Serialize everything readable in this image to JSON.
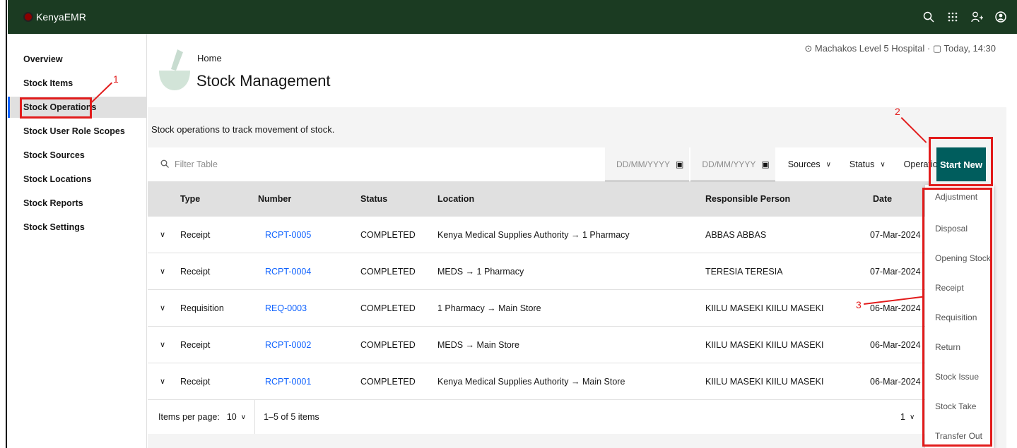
{
  "app": {
    "name": "KenyaEMR"
  },
  "topbar": {
    "icons": [
      "search-icon",
      "app-switcher-icon",
      "add-user-icon",
      "user-avatar-icon"
    ]
  },
  "sidenav": {
    "items": [
      {
        "label": "Overview"
      },
      {
        "label": "Stock Items"
      },
      {
        "label": "Stock Operations"
      },
      {
        "label": "Stock User Role Scopes"
      },
      {
        "label": "Stock Sources"
      },
      {
        "label": "Stock Locations"
      },
      {
        "label": "Stock Reports"
      },
      {
        "label": "Stock Settings"
      }
    ]
  },
  "header": {
    "breadcrumb": "Home",
    "title": "Stock Management",
    "facility": "Machakos Level 5 Hospital",
    "separator": "·",
    "datetime": "Today, 14:30"
  },
  "content": {
    "description": "Stock operations to track movement of stock.",
    "filter_placeholder": "Filter Table",
    "date_from_placeholder": "DD/MM/YYYY",
    "date_to_placeholder": "DD/MM/YYYY",
    "sources_label": "Sources",
    "status_label": "Status",
    "operation_label": "Operation",
    "start_new_label": "Start New"
  },
  "table": {
    "columns": [
      "Type",
      "Number",
      "Status",
      "Location",
      "Responsible Person",
      "Date"
    ],
    "rows": [
      {
        "type": "Receipt",
        "number": "RCPT-0005",
        "status": "COMPLETED",
        "location": "Kenya Medical Supplies Authority → 1 Pharmacy",
        "person": "ABBAS ABBAS",
        "date": "07-Mar-2024"
      },
      {
        "type": "Receipt",
        "number": "RCPT-0004",
        "status": "COMPLETED",
        "location": "MEDS → 1 Pharmacy",
        "person": "TERESIA TERESIA",
        "date": "07-Mar-2024"
      },
      {
        "type": "Requisition",
        "number": "REQ-0003",
        "status": "COMPLETED",
        "location": "1 Pharmacy → Main Store",
        "person": "KIILU MASEKI KIILU MASEKI",
        "date": "06-Mar-2024"
      },
      {
        "type": "Receipt",
        "number": "RCPT-0002",
        "status": "COMPLETED",
        "location": "MEDS → Main Store",
        "person": "KIILU MASEKI KIILU MASEKI",
        "date": "06-Mar-2024"
      },
      {
        "type": "Receipt",
        "number": "RCPT-0001",
        "status": "COMPLETED",
        "location": "Kenya Medical Supplies Authority → Main Store",
        "person": "KIILU MASEKI KIILU MASEKI",
        "date": "06-Mar-2024"
      }
    ]
  },
  "pagination": {
    "items_per_page_label": "Items per page:",
    "items_per_page": "10",
    "range": "1–5 of 5 items",
    "page": "1"
  },
  "menu": {
    "items": [
      "Adjustment",
      "Disposal",
      "Opening Stock",
      "Receipt",
      "Requisition",
      "Return",
      "Stock Issue",
      "Stock Take",
      "Transfer Out"
    ]
  },
  "annotations": [
    "1",
    "2",
    "3"
  ],
  "colors": {
    "topbar": "#1b3b22",
    "accent": "#005d5d",
    "link": "#0f62fe",
    "annotation": "#e21b1b"
  }
}
